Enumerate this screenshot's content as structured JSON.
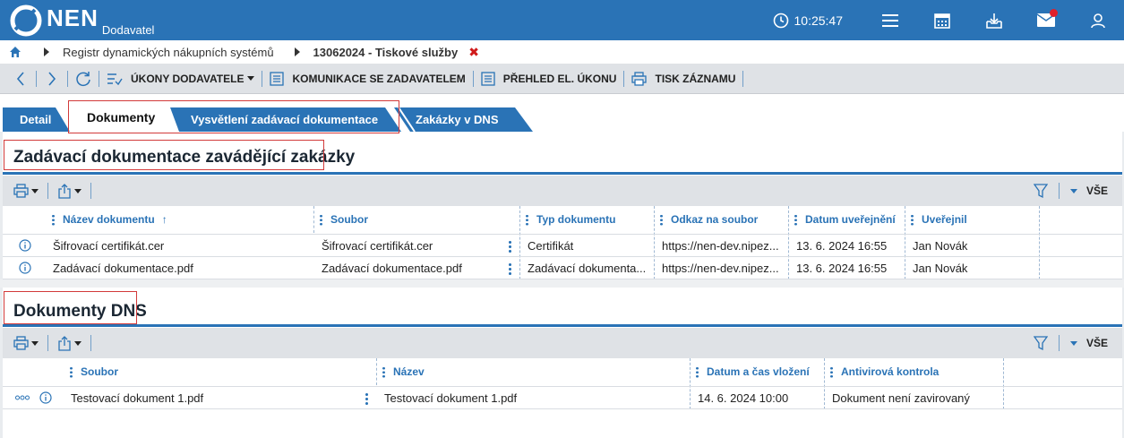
{
  "header": {
    "brand": "NEN",
    "subtitle": "Dodavatel",
    "time": "10:25:47"
  },
  "breadcrumb": {
    "items": [
      "Registr dynamických nákupních systémů",
      "13062024 - Tiskové služby"
    ],
    "close": "✖"
  },
  "toolbar": {
    "ukony": "ÚKONY DODAVATELE",
    "komunikace": "KOMUNIKACE SE ZADAVATELEM",
    "prehled": "PŘEHLED EL. ÚKONU",
    "tisk": "TISK ZÁZNAMU"
  },
  "tabs": [
    {
      "label": "Detail"
    },
    {
      "label": "Dokumenty"
    },
    {
      "label": "Vysvětlení zadávací dokumentace"
    },
    {
      "label": "Zakázky v DNS"
    }
  ],
  "section1": {
    "title": "Zadávací dokumentace zavádějící zakázky",
    "all_label": "VŠE",
    "columns": [
      "Název dokumentu",
      "Soubor",
      "Typ dokumentu",
      "Odkaz na soubor",
      "Datum uveřejnění",
      "Uveřejnil"
    ],
    "sort_indicator": "↑",
    "rows": [
      {
        "nazev": "Šifrovací certifikát.cer",
        "soubor": "Šifrovací certifikát.cer",
        "typ": "Certifikát",
        "odkaz": "https://nen-dev.nipez...",
        "datum": "13. 6. 2024 16:55",
        "uverejnil": "Jan Novák"
      },
      {
        "nazev": "Zadávací dokumentace.pdf",
        "soubor": "Zadávací dokumentace.pdf",
        "typ": "Zadávací dokumenta...",
        "odkaz": "https://nen-dev.nipez...",
        "datum": "13. 6. 2024 16:55",
        "uverejnil": "Jan Novák"
      }
    ]
  },
  "section2": {
    "title": "Dokumenty DNS",
    "all_label": "VŠE",
    "columns": [
      "Soubor",
      "Název",
      "Datum a čas vložení",
      "Antivirová kontrola"
    ],
    "rows": [
      {
        "soubor": "Testovací dokument 1.pdf",
        "nazev": "Testovací dokument 1.pdf",
        "datum": "14. 6. 2024 10:00",
        "kontrola": "Dokument není zavirovaný"
      }
    ]
  },
  "colors": {
    "brand_blue": "#2a73b6",
    "highlight_red": "#d23a3a",
    "notification_red": "#e0202a"
  }
}
